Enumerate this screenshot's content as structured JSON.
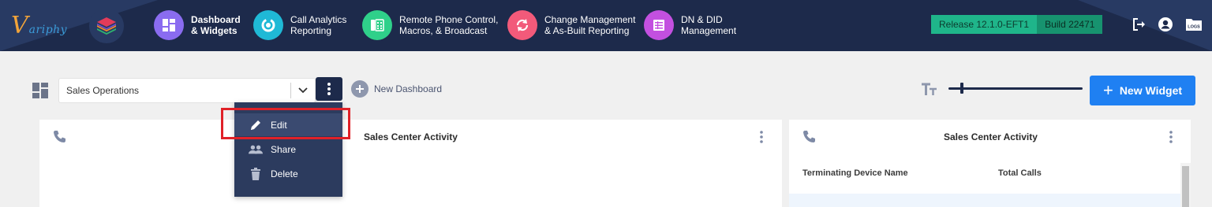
{
  "app": {
    "logo_initial": "V",
    "logo_rest": "ariphy"
  },
  "nav": {
    "items": [
      {
        "line1": "Dashboard",
        "line2": "& Widgets",
        "icon": "dashboard-icon",
        "color": "#8a6cf0",
        "active": true
      },
      {
        "line1": "Call Analytics",
        "line2": "Reporting",
        "icon": "refresh-circle-icon",
        "color": "#1fb9d6"
      },
      {
        "line1": "Remote Phone Control,",
        "line2": "Macros, & Broadcast",
        "icon": "phone-keypad-icon",
        "color": "#2fd08a"
      },
      {
        "line1": "Change Management",
        "line2": "& As-Built Reporting",
        "icon": "sync-icon",
        "color": "#f25a7a"
      },
      {
        "line1": "DN & DID",
        "line2": "Management",
        "icon": "list-icon",
        "color": "#c350e0"
      }
    ],
    "release": "Release 12.1.0-EFT1",
    "build": "Build 22471"
  },
  "toolbar": {
    "dashboard_selected": "Sales Operations",
    "new_dashboard_label": "New Dashboard",
    "new_widget_label": "New Widget",
    "text_size_fraction": 0.09
  },
  "menu": {
    "edit": "Edit",
    "share": "Share",
    "delete": "Delete"
  },
  "widgets": [
    {
      "title": "Sales Center Activity"
    },
    {
      "title": "Sales Center Activity",
      "columns": [
        "Terminating Device Name",
        "Total Calls"
      ]
    }
  ],
  "colors": {
    "navbar": "#1d2a4b",
    "accent": "#1f80f2",
    "release": "#1fb58a",
    "highlight": "#e02128"
  }
}
